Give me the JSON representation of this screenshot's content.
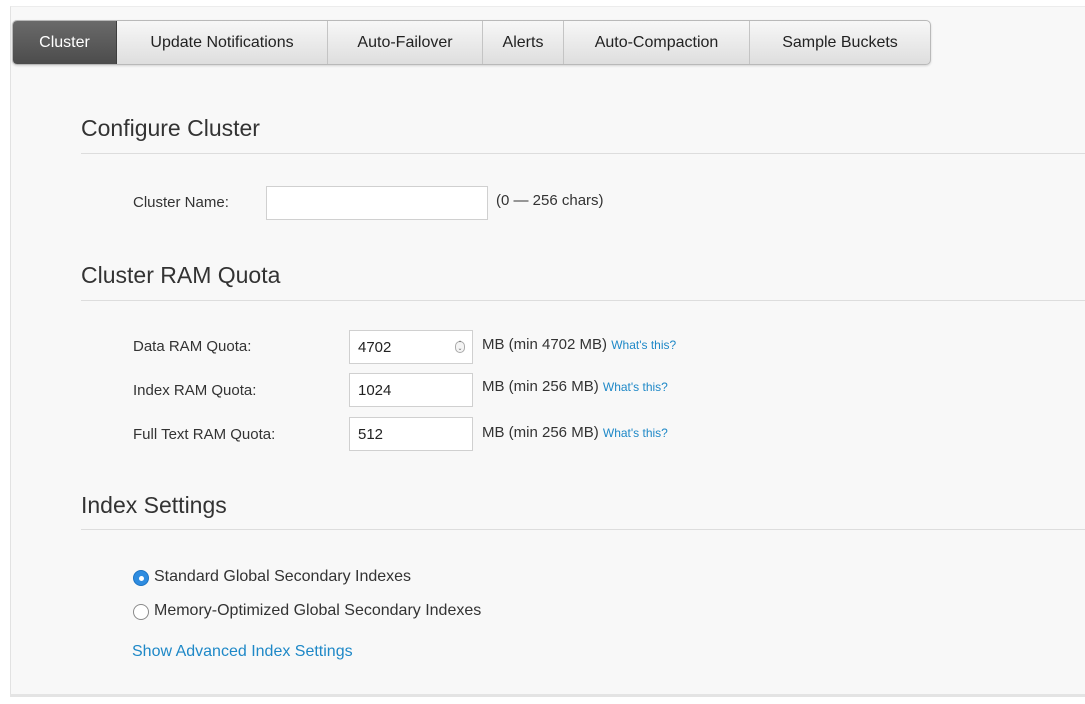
{
  "tabs": [
    {
      "label": "Cluster",
      "active": true
    },
    {
      "label": "Update Notifications",
      "active": false
    },
    {
      "label": "Auto-Failover",
      "active": false
    },
    {
      "label": "Alerts",
      "active": false
    },
    {
      "label": "Auto-Compaction",
      "active": false
    },
    {
      "label": "Sample Buckets",
      "active": false
    }
  ],
  "configure_cluster": {
    "title": "Configure Cluster",
    "cluster_name_label": "Cluster Name:",
    "cluster_name_value": "",
    "cluster_name_hint": "(0 — 256 chars)"
  },
  "ram_quota": {
    "title": "Cluster RAM Quota",
    "rows": [
      {
        "label": "Data RAM Quota:",
        "value": "4702",
        "min": "MB (min 4702 MB)",
        "help": "What's this?"
      },
      {
        "label": "Index RAM Quota:",
        "value": "1024",
        "min": "MB (min 256 MB)",
        "help": "What's this?"
      },
      {
        "label": "Full Text RAM Quota:",
        "value": "512",
        "min": "MB (min 256 MB)",
        "help": "What's this?"
      }
    ]
  },
  "index_settings": {
    "title": "Index Settings",
    "options": [
      {
        "label": "Standard Global Secondary Indexes",
        "selected": true
      },
      {
        "label": "Memory-Optimized Global Secondary Indexes",
        "selected": false
      }
    ],
    "advanced_link": "Show Advanced Index Settings"
  },
  "colors": {
    "accent": "#1e88c7",
    "tab_active_bg": "#555555",
    "radio_selected": "#2e8ce0"
  }
}
